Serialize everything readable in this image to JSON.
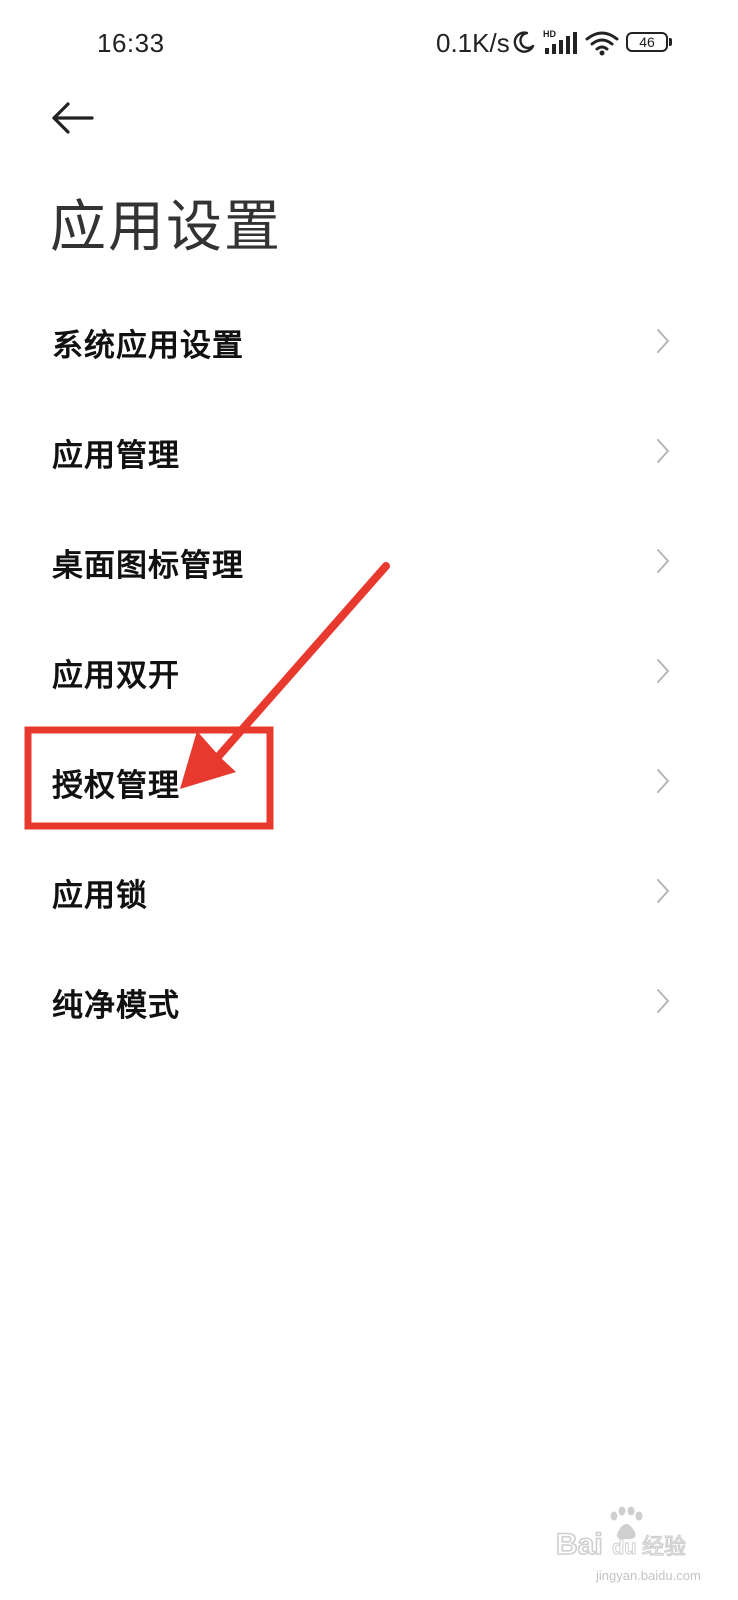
{
  "status_bar": {
    "time": "16:33",
    "network_speed": "0.1K/s",
    "icons": [
      "moon-icon",
      "hd-signal-icon",
      "wifi-icon"
    ],
    "battery_level": "46"
  },
  "header": {
    "back_icon": "back-arrow-icon",
    "title": "应用设置"
  },
  "menu": {
    "items": [
      {
        "label": "系统应用设置"
      },
      {
        "label": "应用管理"
      },
      {
        "label": "桌面图标管理"
      },
      {
        "label": "应用双开"
      },
      {
        "label": "授权管理"
      },
      {
        "label": "应用锁"
      },
      {
        "label": "纯净模式"
      }
    ]
  },
  "annotation": {
    "highlight_color": "#e8392f",
    "highlighted_item": "授权管理"
  },
  "watermark": {
    "text": "Bai du 经验",
    "url_text": "jingyan.baidu.com"
  }
}
